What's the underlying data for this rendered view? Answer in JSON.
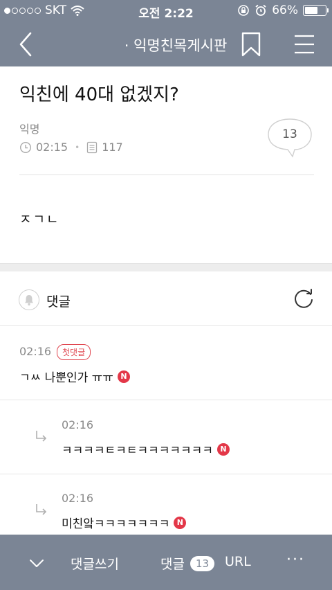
{
  "status_bar": {
    "carrier": "SKT",
    "time": "오전 2:22",
    "battery": "66%",
    "battery_level": 0.66,
    "signal_bars_filled": 1,
    "signal_bars_total": 5
  },
  "nav": {
    "title": "· 익명친목게시판",
    "icons": [
      "back-icon",
      "bookmark-icon",
      "menu-icon"
    ]
  },
  "post": {
    "title": "익친에 40대 없겠지?",
    "author": "익명",
    "time": "02:15",
    "views": "117",
    "comment_count": "13",
    "body": "ㅈㄱㄴ"
  },
  "comments_section": {
    "label": "댓글",
    "comments": [
      {
        "time": "02:16",
        "badge": "첫댓글",
        "text": "ㄱㅆ 나뿐인가 ㅠㅠ",
        "new": "N",
        "reply": false
      },
      {
        "time": "02:16",
        "text": "ㅋㅋㅋㅋㅌㅋㅌㅋㅋㅋㅋㅋㅋㅋ",
        "new": "N",
        "reply": true
      },
      {
        "time": "02:16",
        "text": "미친앜ㅋㅋㅋㅋㅋㅋㅋ",
        "new": "N",
        "reply": true
      }
    ]
  },
  "bottom_bar": {
    "write_label": "댓글쓰기",
    "comments_label": "댓글",
    "comments_count": "13",
    "url_label": "URL",
    "more_label": "···"
  },
  "colors": {
    "bar": "#7b8595",
    "accent_red": "#e33748"
  }
}
